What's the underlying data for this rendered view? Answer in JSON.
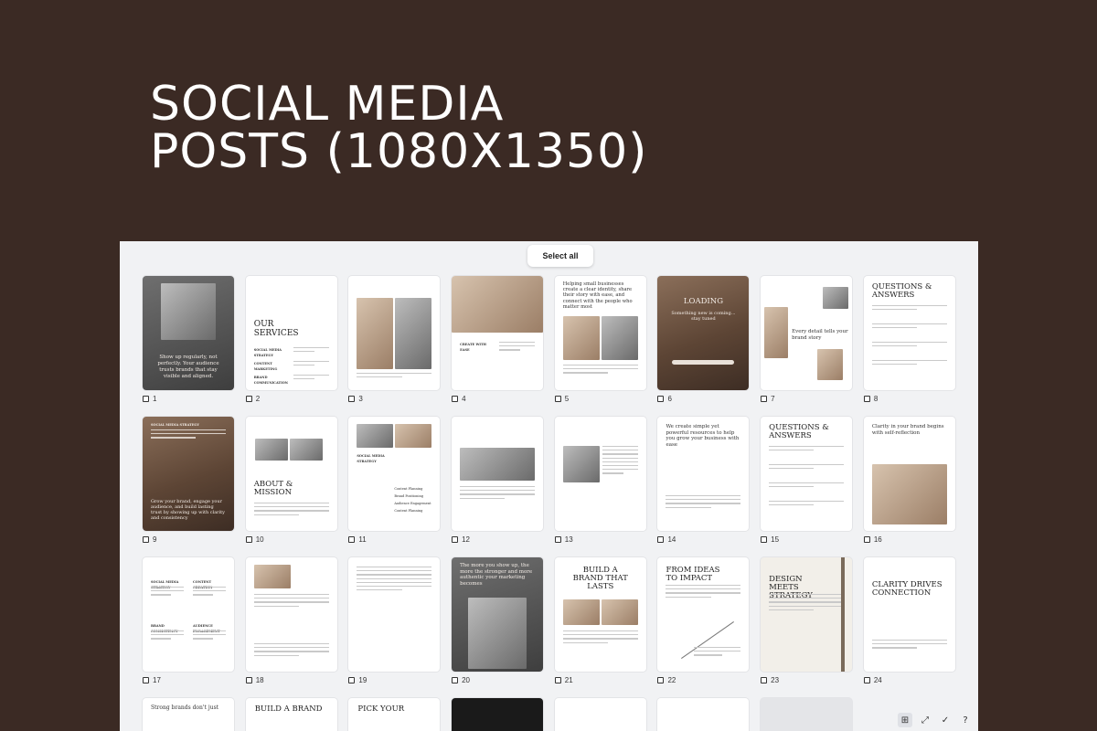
{
  "hero": {
    "line1": "SOCIAL MEDIA",
    "line2": "POSTS (1080X1350)"
  },
  "panel": {
    "select_all_label": "Select all"
  },
  "tiles": [
    {
      "n": "1",
      "kind": "bw",
      "text": "Show up regularly, not perfectly. Your audience trusts brands that stay visible and aligned."
    },
    {
      "n": "2",
      "kind": "white",
      "title": "OUR SERVICES",
      "items": [
        "SOCIAL MEDIA STRATEGY",
        "CONTENT MARKETING",
        "BRAND COMMUNICATION"
      ]
    },
    {
      "n": "3",
      "kind": "white",
      "title": ""
    },
    {
      "n": "4",
      "kind": "white",
      "title": "",
      "caption": "CREATE WITH EASE"
    },
    {
      "n": "5",
      "kind": "white",
      "text": "Helping small businesses create a clear identity, share their story with ease, and connect with the people who matter most"
    },
    {
      "n": "6",
      "kind": "photo",
      "title": "LOADING",
      "text": "Something new is coming... stay tuned"
    },
    {
      "n": "7",
      "kind": "white",
      "text": "Every detail tells your brand story"
    },
    {
      "n": "8",
      "kind": "white",
      "title": "QUESTIONS & ANSWERS"
    },
    {
      "n": "9",
      "kind": "photo",
      "caption": "SOCIAL MEDIA STRATEGY",
      "text": "Grow your brand, engage your audience, and build lasting trust by showing up with clarity and consistency"
    },
    {
      "n": "10",
      "kind": "white",
      "title": "ABOUT & MISSION"
    },
    {
      "n": "11",
      "kind": "white",
      "caption": "SOCIAL MEDIA STRATEGY",
      "items": [
        "Content Planning",
        "Brand Positioning",
        "Audience Engagement",
        "Content Planning"
      ]
    },
    {
      "n": "12",
      "kind": "white"
    },
    {
      "n": "13",
      "kind": "white"
    },
    {
      "n": "14",
      "kind": "white",
      "text": "We create simple yet powerful resources to help you grow your business with ease"
    },
    {
      "n": "15",
      "kind": "white",
      "title": "QUESTIONS & ANSWERS"
    },
    {
      "n": "16",
      "kind": "white",
      "text": "Clarity in your brand begins with self-reflection"
    },
    {
      "n": "17",
      "kind": "white",
      "items": [
        "SOCIAL MEDIA STRATEGY",
        "CONTENT CREATION",
        "BRAND CONSISTENCY",
        "AUDIENCE ENGAGEMENT"
      ]
    },
    {
      "n": "18",
      "kind": "white"
    },
    {
      "n": "19",
      "kind": "white"
    },
    {
      "n": "20",
      "kind": "bw",
      "text": "The more you show up, the more the stronger and more authentic your marketing becomes"
    },
    {
      "n": "21",
      "kind": "white",
      "title": "BUILD A BRAND THAT LASTS"
    },
    {
      "n": "22",
      "kind": "white",
      "title": "FROM IDEAS TO IMPACT"
    },
    {
      "n": "23",
      "kind": "cream",
      "title": "DESIGN MEETS STRATEGY"
    },
    {
      "n": "24",
      "kind": "white",
      "title": "CLARITY DRIVES CONNECTION"
    }
  ],
  "bottom_row": [
    {
      "kind": "white",
      "text": "Strong brands don't just"
    },
    {
      "kind": "white",
      "title": "BUILD A BRAND"
    },
    {
      "kind": "white",
      "title": "PICK YOUR"
    },
    {
      "kind": "dark"
    },
    {
      "kind": "white"
    },
    {
      "kind": "white"
    },
    {
      "kind": "grey"
    },
    {
      "kind": "none"
    }
  ],
  "toolbar": {
    "grid_icon": "⊞",
    "expand_icon": "⤢",
    "check_icon": "✓",
    "help_icon": "?"
  },
  "colors": {
    "background": "#3b2a24",
    "panel": "#f1f2f4"
  }
}
